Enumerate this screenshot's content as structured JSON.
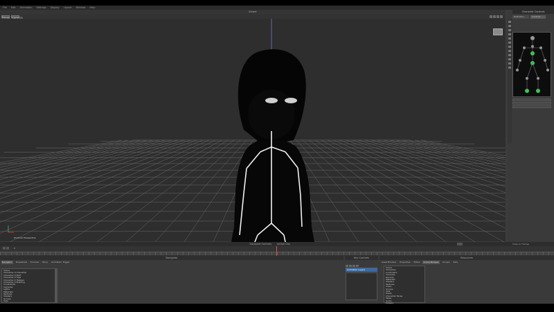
{
  "menubar": {
    "items": [
      "File",
      "Edit",
      "Animation",
      "Settings",
      "Display",
      "Layout",
      "Window",
      "Help"
    ]
  },
  "viewport": {
    "title": "Viewer",
    "left_buttons": [
      "Persp",
      "Camera"
    ],
    "camera_label": "Producer Perspective"
  },
  "right_panel": {
    "title": "Character Controls",
    "tabs": [
      "Definition",
      "Controls"
    ]
  },
  "timeline": {
    "title": "Transport Controls",
    "record_label": "Action Clip",
    "frame_label": "0",
    "right_label": "Snap on Frames"
  },
  "bottom": {
    "navigator_title": "Navigator",
    "navigator_tabs": [
      "Navigator",
      "Dopesheet",
      "FCurves",
      "Story",
      "Animation Trigger"
    ],
    "navigator_tree": [
      "Scene",
      "Character 0 Character",
      "Character 0 Root",
      "Character 0 Hips",
      "Character 0 Helpers",
      "Character 0 Building",
      "Constraints",
      "Cameras",
      "Lights",
      "Materials",
      "Textures",
      "Shaders",
      "Groups",
      "Sets"
    ],
    "key_controls_title": "Key Controls",
    "key_controls_tab": "Animation Layers",
    "resources_title": "Resources",
    "resources_tabs": [
      "Asset Browser",
      "Properties",
      "Filters",
      "Scene Browser",
      "Groups",
      "Sets"
    ],
    "resources_tree": [
      "Scene",
      "Character",
      "Controllers",
      "Cameras",
      "Devices",
      "Materials",
      "Shaders",
      "Textures",
      "Video",
      "Groups",
      "Sets",
      "Poses",
      "Character Faces",
      "Takes",
      "Audio",
      "Solvers"
    ]
  },
  "colors": {
    "background": "#2e2e2e",
    "grid": "#6a6a6a",
    "skeleton": "#f2f2f2",
    "effector": "#3cc85a",
    "selection_blue": "#3e6a9c"
  }
}
